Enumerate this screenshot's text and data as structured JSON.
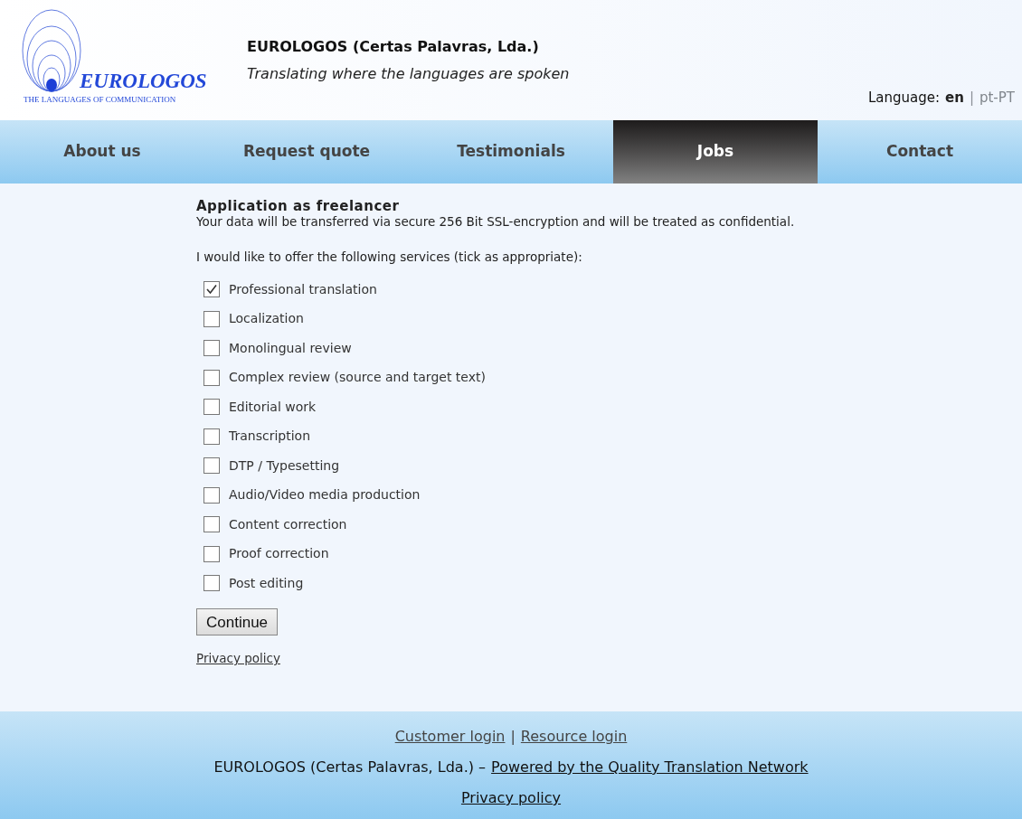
{
  "logo": {
    "name": "EUROLOGOS",
    "tagline": "THE LANGUAGES OF COMMUNICATION"
  },
  "header": {
    "company": "EUROLOGOS (Certas Palavras, Lda.)",
    "slogan": "Translating where the languages are spoken"
  },
  "language": {
    "label": "Language:",
    "separator": "|",
    "options": [
      {
        "label": "en",
        "selected": true
      },
      {
        "label": "pt-PT",
        "selected": false
      }
    ]
  },
  "nav": [
    {
      "label": "About us",
      "selected": false
    },
    {
      "label": "Request quote",
      "selected": false
    },
    {
      "label": "Testimonials",
      "selected": false
    },
    {
      "label": "Jobs",
      "selected": true
    },
    {
      "label": "Contact",
      "selected": false
    }
  ],
  "form": {
    "title": "Application as freelancer",
    "note": "Your data will be transferred via secure 256 Bit SSL-encryption and will be treated as confidential.",
    "prompt": "I would like to offer the following services (tick as appropriate):",
    "services": [
      {
        "label": "Professional translation",
        "checked": true
      },
      {
        "label": "Localization",
        "checked": false
      },
      {
        "label": "Monolingual review",
        "checked": false
      },
      {
        "label": "Complex review (source and target text)",
        "checked": false
      },
      {
        "label": "Editorial work",
        "checked": false
      },
      {
        "label": "Transcription",
        "checked": false
      },
      {
        "label": "DTP / Typesetting",
        "checked": false
      },
      {
        "label": "Audio/Video media production",
        "checked": false
      },
      {
        "label": "Content correction",
        "checked": false
      },
      {
        "label": "Proof correction",
        "checked": false
      },
      {
        "label": "Post editing",
        "checked": false
      }
    ],
    "button": "Continue",
    "privacy_link": "Privacy policy"
  },
  "footer": {
    "logins": [
      "Customer login",
      "Resource login"
    ],
    "separator": "|",
    "company": "EUROLOGOS (Certas Palavras, Lda.) –",
    "network_link": "Powered by the Quality Translation Network",
    "privacy_link": "Privacy policy"
  }
}
